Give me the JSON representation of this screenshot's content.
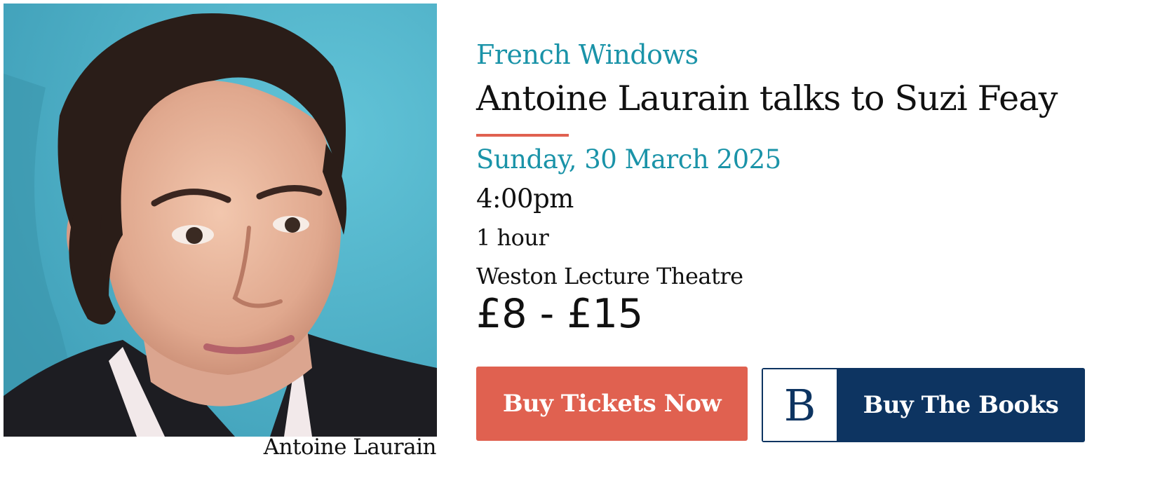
{
  "photo": {
    "alt": "Antoine Laurain",
    "caption": "Antoine Laurain",
    "background_color": "#5ebfd3"
  },
  "event": {
    "series": "French Windows",
    "title": "Antoine Laurain talks to Suzi Feay",
    "date": "Sunday, 30 March 2025",
    "time": "4:00pm",
    "duration": "1 hour",
    "venue": "Weston Lecture Theatre",
    "price": "£8 - £15"
  },
  "actions": {
    "buy_tickets_label": "Buy Tickets Now",
    "buy_books_logo": "B",
    "buy_books_label": "Buy The Books"
  },
  "colors": {
    "accent_teal": "#1a93a8",
    "accent_coral": "#e06150",
    "navy": "#0d3461"
  }
}
